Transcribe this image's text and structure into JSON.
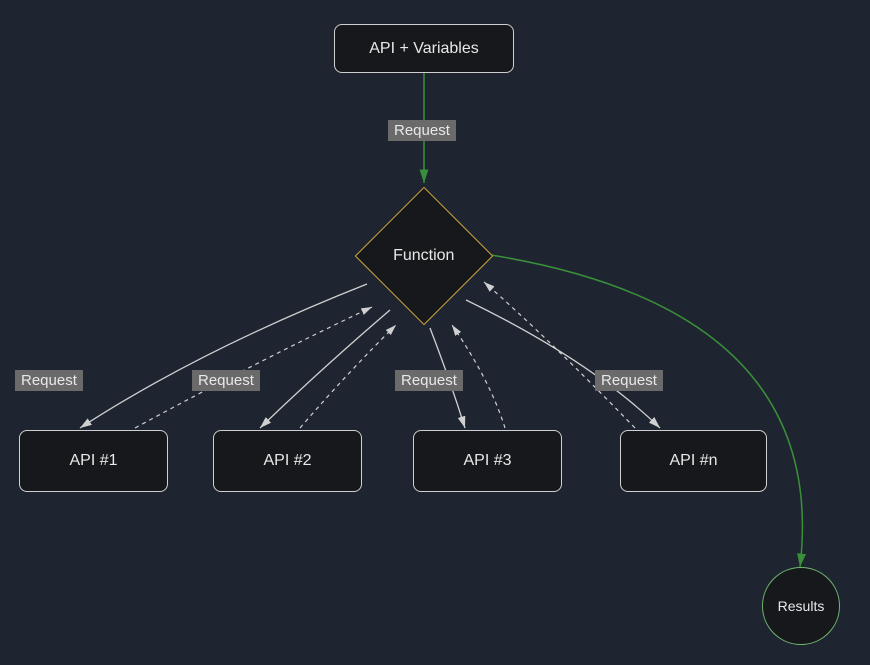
{
  "nodes": {
    "apiVariables": {
      "label": "API + Variables"
    },
    "function": {
      "label": "Function"
    },
    "api1": {
      "label": "API #1"
    },
    "api2": {
      "label": "API #2"
    },
    "api3": {
      "label": "API #3"
    },
    "apiN": {
      "label": "API #n"
    },
    "results": {
      "label": "Results"
    }
  },
  "edgeLabels": {
    "topRequest": "Request",
    "req1": "Request",
    "req2": "Request",
    "req3": "Request",
    "reqN": "Request"
  },
  "colors": {
    "background": "#1e2530",
    "nodeFill": "#16181c",
    "nodeBorder": "#d0d0d0",
    "diamondBorder": "#d4a93f",
    "circleBorder": "#6fb86f",
    "edgeGreen": "#3a8f3a",
    "edgeWhite": "#d0d0d0",
    "labelBg": "#6a6a6a",
    "text": "#e8e8e8"
  }
}
